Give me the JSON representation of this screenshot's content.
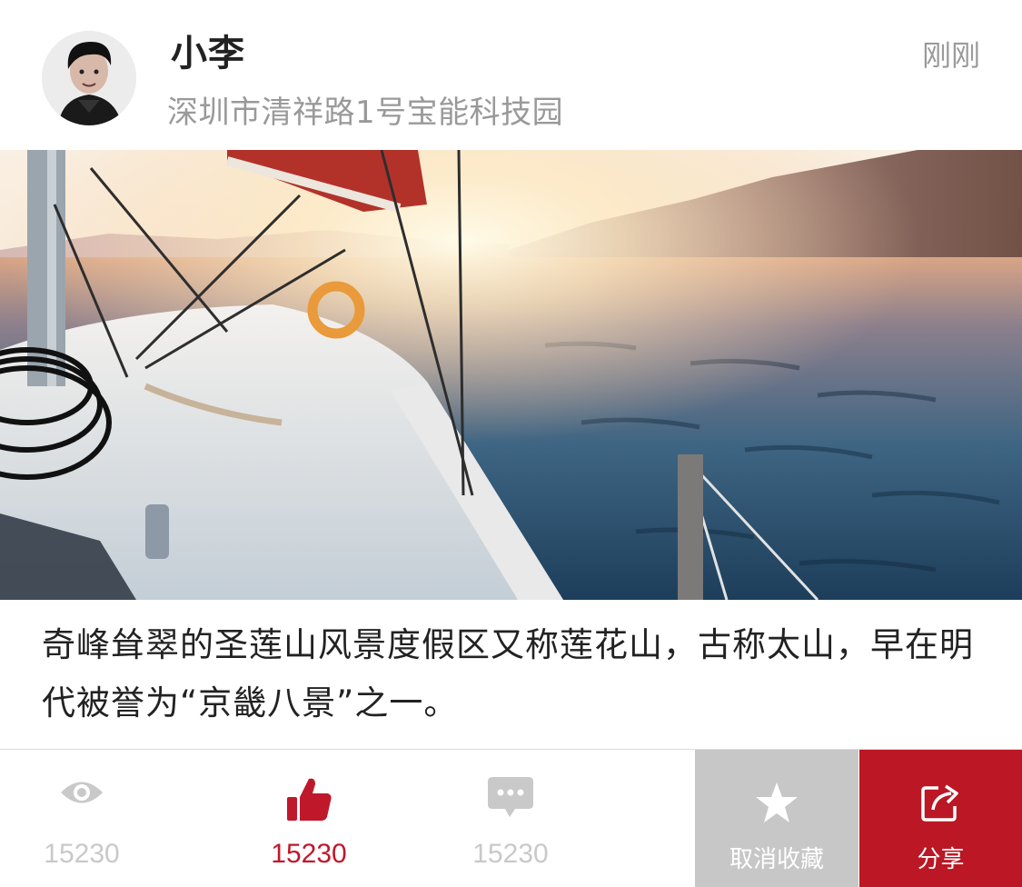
{
  "post": {
    "username": "小李",
    "location": "深圳市清祥路1号宝能科技园",
    "time": "刚刚",
    "caption": "奇峰耸翠的圣莲山风景度假区又称莲花山，古称太山，早在明代被誉为“京畿八景”之一。"
  },
  "stats": {
    "views": "15230",
    "likes": "15230",
    "comments": "15230"
  },
  "actions": {
    "favorite_label": "取消收藏",
    "share_label": "分享"
  },
  "icons": {
    "views": "eye-icon",
    "likes": "thumbs-up-icon",
    "comments": "chat-bubble-icon",
    "favorite": "star-icon",
    "share": "share-icon"
  },
  "colors": {
    "accent_red": "#c0182b",
    "muted_gray": "#c9c9c9",
    "favorite_bg": "#c7c7c7",
    "share_bg": "#bb1724"
  }
}
